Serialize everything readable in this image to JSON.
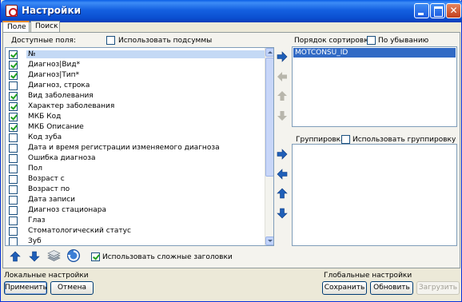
{
  "window": {
    "title": "Настройки"
  },
  "tabs": [
    {
      "label": "Поле"
    },
    {
      "label": "Поиск"
    }
  ],
  "left": {
    "available_label": "Доступные поля:",
    "use_subtotals_label": "Использовать подсуммы",
    "use_subtotals_checked": false,
    "fields": [
      {
        "label": "№",
        "checked": true,
        "selected": true
      },
      {
        "label": "Диагноз|Вид*",
        "checked": true,
        "selected": false
      },
      {
        "label": "Диагноз|Тип*",
        "checked": true,
        "selected": false
      },
      {
        "label": "Диагноз, строка",
        "checked": false,
        "selected": false
      },
      {
        "label": "Вид заболевания",
        "checked": true,
        "selected": false
      },
      {
        "label": "Характер заболевания",
        "checked": true,
        "selected": false
      },
      {
        "label": "МКБ Код",
        "checked": true,
        "selected": false
      },
      {
        "label": "МКБ Описание",
        "checked": true,
        "selected": false
      },
      {
        "label": "Код зуба",
        "checked": false,
        "selected": false
      },
      {
        "label": "Дата и время регистрации изменяемого диагноза",
        "checked": false,
        "selected": false
      },
      {
        "label": "Ошибка диагноза",
        "checked": false,
        "selected": false
      },
      {
        "label": "Пол",
        "checked": false,
        "selected": false
      },
      {
        "label": "Возраст с",
        "checked": false,
        "selected": false
      },
      {
        "label": "Возраст по",
        "checked": false,
        "selected": false
      },
      {
        "label": "Дата записи",
        "checked": false,
        "selected": false
      },
      {
        "label": "Диагноз стационара",
        "checked": false,
        "selected": false
      },
      {
        "label": "Глаз",
        "checked": false,
        "selected": false
      },
      {
        "label": "Стоматологический статус",
        "checked": false,
        "selected": false
      },
      {
        "label": "Зуб",
        "checked": false,
        "selected": false
      }
    ],
    "complex_headers_label": "Использовать сложные заголовки",
    "complex_headers_checked": true
  },
  "right": {
    "sort_order_label": "Порядок сортировки:",
    "descending_label": "По убыванию",
    "descending_checked": false,
    "sort_items": [
      "MOTCONSU_ID"
    ],
    "grouping_label": "Группировка",
    "use_grouping_label": "Использовать группировку",
    "use_grouping_checked": false
  },
  "footer": {
    "local_label": "Локальные настройки",
    "apply_label": "Применить",
    "cancel_label": "Отмена",
    "global_label": "Глобальные настройки",
    "save_label": "Сохранить",
    "refresh_label": "Обновить",
    "load_label": "Загрузить"
  },
  "colors": {
    "titlebar": "#0a5ee6",
    "selection": "#316ac5",
    "arrow_active": "#1f5fb8",
    "arrow_disabled": "#b8b6ac"
  }
}
